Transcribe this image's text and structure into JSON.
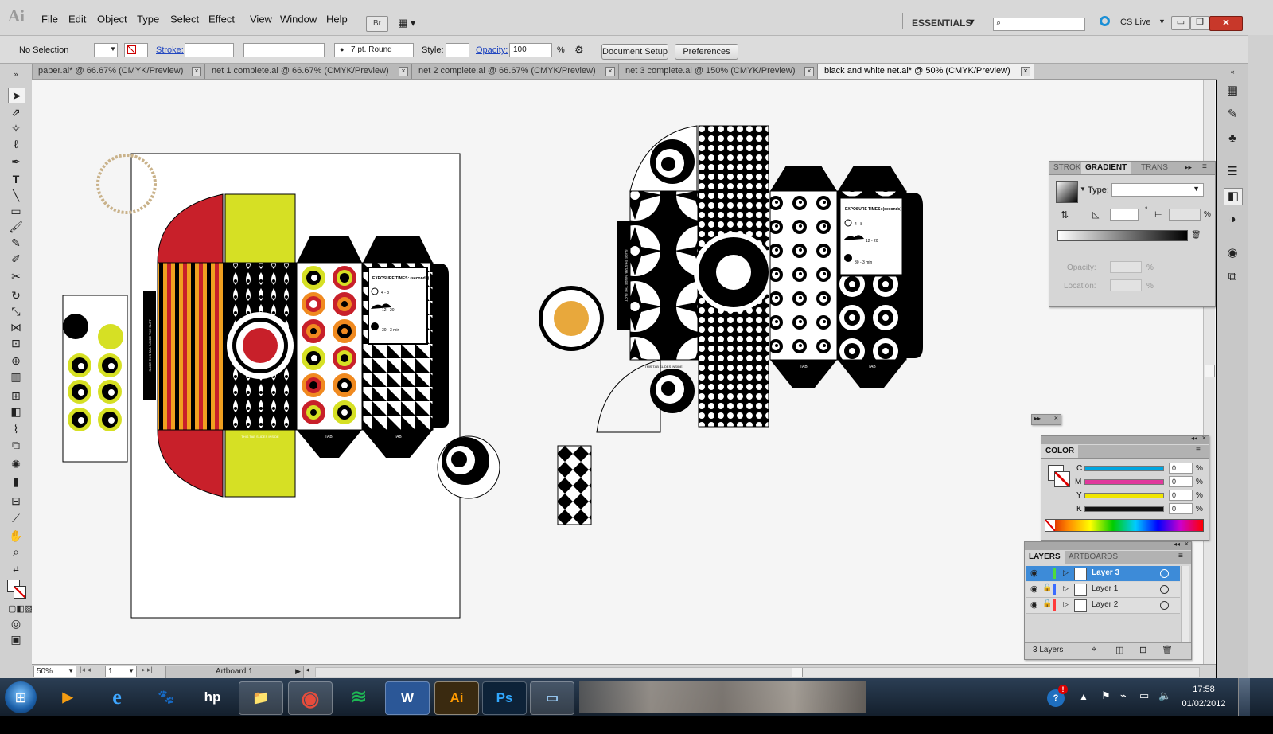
{
  "app": {
    "logo": "Ai"
  },
  "menubar": {
    "items": [
      "File",
      "Edit",
      "Object",
      "Type",
      "Select",
      "Effect",
      "View",
      "Window",
      "Help"
    ],
    "bridge_label": "Br",
    "workspace": "ESSENTIALS",
    "search_placeholder": "",
    "cs_live": "CS Live"
  },
  "control_bar": {
    "selection": "No Selection",
    "stroke_label": "Stroke:",
    "brush_label": "7 pt. Round",
    "style_label": "Style:",
    "opacity_label": "Opacity:",
    "opacity_value": "100",
    "percent": "%",
    "document_setup": "Document Setup",
    "preferences": "Preferences"
  },
  "tabs": [
    {
      "label": "paper.ai* @ 66.67% (CMYK/Preview)",
      "active": false
    },
    {
      "label": "net 1 complete.ai @ 66.67% (CMYK/Preview)",
      "active": false
    },
    {
      "label": "net 2 complete.ai @ 66.67% (CMYK/Preview)",
      "active": false
    },
    {
      "label": "net 3 complete.ai @ 150% (CMYK/Preview)",
      "active": false
    },
    {
      "label": "black and white net.ai* @ 50% (CMYK/Preview)",
      "active": true
    }
  ],
  "artwork": {
    "slide_text": "SLIDE THIS TAB INSIDE THE SLOT",
    "tab_text": "TAB",
    "tuck_text": "THIS TAB SLIDES INSIDE",
    "exposure_title": "EXPOSURE TIMES: (seconds)",
    "exposure_rows": [
      "4 - 8",
      "12 - 20",
      "30 - 3 min"
    ]
  },
  "gradient_panel": {
    "tabs": [
      "STROK",
      "GRADIENT",
      "TRANS"
    ],
    "type_label": "Type:",
    "opacity_label": "Opacity:",
    "location_label": "Location:",
    "percent": "%"
  },
  "color_panel": {
    "title": "COLOR",
    "channels": [
      {
        "name": "C",
        "value": "0",
        "color": "#00a6e0"
      },
      {
        "name": "M",
        "value": "0",
        "color": "#e0389c"
      },
      {
        "name": "Y",
        "value": "0",
        "color": "#f0e600"
      },
      {
        "name": "K",
        "value": "0",
        "color": "#111111"
      }
    ],
    "percent": "%"
  },
  "layers_panel": {
    "tabs": [
      "LAYERS",
      "ARTBOARDS"
    ],
    "layers": [
      {
        "name": "Layer 3",
        "color": "#4fdc3c",
        "selected": true
      },
      {
        "name": "Layer 1",
        "color": "#3c6cff",
        "selected": false
      },
      {
        "name": "Layer 2",
        "color": "#ff3c3c",
        "selected": false
      }
    ],
    "count": "3 Layers"
  },
  "status": {
    "zoom": "50%",
    "artboard_num": "1",
    "artboard_name": "Artboard 1"
  },
  "taskbar": {
    "time": "17:58",
    "date": "01/02/2012",
    "apps": [
      {
        "name": "windows-media-player",
        "glyph": "▶"
      },
      {
        "name": "internet-explorer",
        "glyph": "e"
      },
      {
        "name": "gimp",
        "glyph": "🐾"
      },
      {
        "name": "hp",
        "glyph": "hp"
      },
      {
        "name": "file-explorer",
        "glyph": "📁"
      },
      {
        "name": "chrome",
        "glyph": "◉"
      },
      {
        "name": "spotify",
        "glyph": "≋"
      },
      {
        "name": "word",
        "glyph": "W"
      },
      {
        "name": "illustrator",
        "glyph": "Ai"
      },
      {
        "name": "photoshop",
        "glyph": "Ps"
      },
      {
        "name": "picture-viewer",
        "glyph": "▭"
      }
    ]
  }
}
